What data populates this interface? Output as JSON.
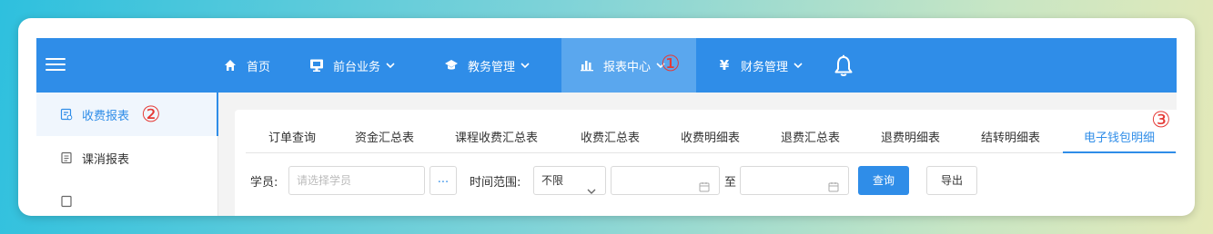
{
  "nav": {
    "items": [
      {
        "label": "首页",
        "icon": "home-icon"
      },
      {
        "label": "前台业务",
        "icon": "monitor-icon"
      },
      {
        "label": "教务管理",
        "icon": "graduation-cap-icon"
      },
      {
        "label": "报表中心",
        "icon": "bar-chart-icon"
      },
      {
        "label": "财务管理",
        "icon": "yen-icon",
        "glyph": "¥"
      }
    ],
    "active": "报表中心"
  },
  "sidebar": {
    "items": [
      {
        "label": "收费报表",
        "icon": "report-icon"
      },
      {
        "label": "课消报表",
        "icon": "document-icon"
      }
    ],
    "active": "收费报表"
  },
  "tabs": {
    "items": [
      "订单查询",
      "资金汇总表",
      "课程收费汇总表",
      "收费汇总表",
      "收费明细表",
      "退费汇总表",
      "退费明细表",
      "结转明细表",
      "电子钱包明细"
    ],
    "active": "电子钱包明细"
  },
  "filters": {
    "student_label": "学员:",
    "student_placeholder": "请选择学员",
    "more_btn": "...",
    "time_label": "时间范围:",
    "time_range_value": "不限",
    "to_label": "至",
    "query_btn": "查询",
    "export_btn": "导出"
  },
  "annotations": {
    "one": "①",
    "two": "②",
    "three": "③"
  },
  "colors": {
    "primary": "#2f8de8",
    "active_nav": "#5aa7ee",
    "annotation": "#e53935"
  }
}
